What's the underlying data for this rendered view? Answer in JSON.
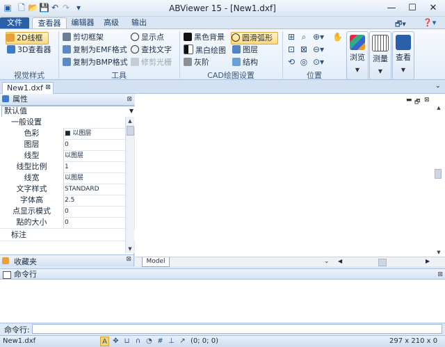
{
  "window": {
    "title": "ABViewer 15 - [New1.dxf]"
  },
  "tabs": {
    "file": "文件",
    "viewer": "查看器",
    "editor": "编辑器",
    "advanced": "高级",
    "output": "输出"
  },
  "ribbon": {
    "visual_style": {
      "label": "视觉样式",
      "wireframe2d": "2D线框",
      "viewer3d": "3D查看器"
    },
    "tools": {
      "label": "工具",
      "clip_frame": "剪切框架",
      "copy_emf": "复制为EMF格式",
      "copy_bmp": "复制为BMP格式",
      "show_point": "显示点",
      "find_text": "查找文字",
      "trim_raster": "修剪光栅"
    },
    "cad_settings": {
      "label": "CAD绘图设置",
      "black_bg": "黑色背景",
      "bw_drawing": "黑白绘图",
      "grayscale": "灰阶",
      "smooth_arc": "圆滑弧形",
      "layers": "图层",
      "structure": "结构"
    },
    "position": {
      "label": "位置"
    },
    "browse": "浏览",
    "measure": "测量",
    "view": "查看"
  },
  "doc_tab": "New1.dxf",
  "properties": {
    "title": "属性",
    "dropdown": "默认值",
    "categories": {
      "general": "一般设置",
      "annotation": "标注"
    },
    "rows": [
      {
        "key": "色彩",
        "value": "■ 以图层"
      },
      {
        "key": "图层",
        "value": "0"
      },
      {
        "key": "线型",
        "value": "以图层"
      },
      {
        "key": "线型比例",
        "value": "1"
      },
      {
        "key": "线宽",
        "value": "以图层"
      },
      {
        "key": "文字样式",
        "value": "STANDARD"
      },
      {
        "key": "字体高",
        "value": "2.5"
      },
      {
        "key": "点显示模式",
        "value": "0"
      },
      {
        "key": "點的大小",
        "value": "0"
      }
    ]
  },
  "favorites": {
    "title": "收藏夹"
  },
  "model_tab": "Model",
  "command": {
    "title": "命令行",
    "prompt": "命令行:",
    "value": ""
  },
  "status": {
    "file": "New1.dxf",
    "coords": "(0; 0; 0)",
    "size": "297 x 210 x 0"
  }
}
